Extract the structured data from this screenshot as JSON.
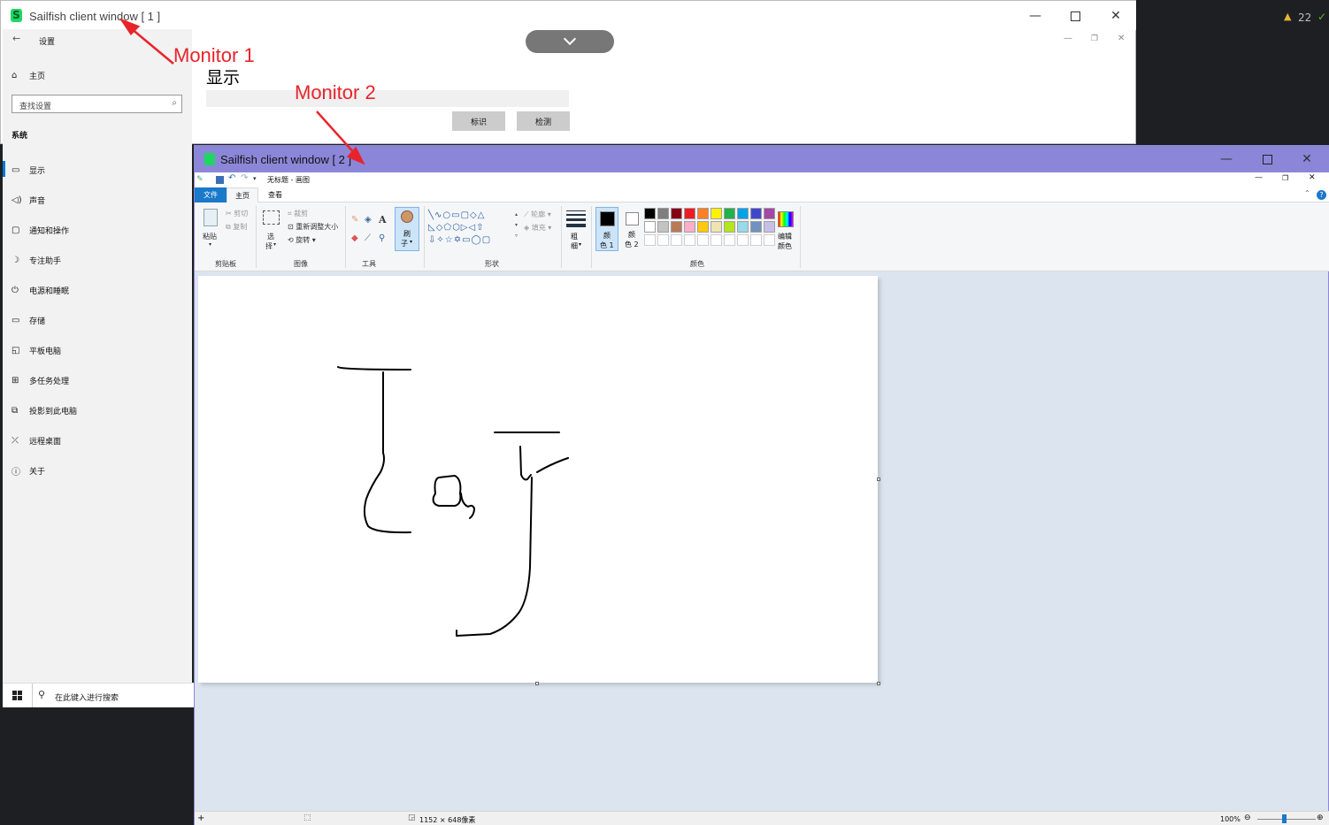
{
  "window1": {
    "title": "Sailfish client window [ 1 ]",
    "dropdown_icon": "chevron-down-icon",
    "page_heading": "显示",
    "buttons": [
      "标识",
      "检测"
    ]
  },
  "settings": {
    "back_label": "设置",
    "home": "主页",
    "search_placeholder": "查找设置",
    "section": "系统",
    "items": [
      {
        "label": "显示",
        "icon": "monitor-icon"
      },
      {
        "label": "声音",
        "icon": "speaker-icon"
      },
      {
        "label": "通知和操作",
        "icon": "notification-icon"
      },
      {
        "label": "专注助手",
        "icon": "moon-icon"
      },
      {
        "label": "电源和睡眠",
        "icon": "power-icon"
      },
      {
        "label": "存储",
        "icon": "storage-icon"
      },
      {
        "label": "平板电脑",
        "icon": "tablet-icon"
      },
      {
        "label": "多任务处理",
        "icon": "multitask-icon"
      },
      {
        "label": "投影到此电脑",
        "icon": "project-icon"
      },
      {
        "label": "远程桌面",
        "icon": "remote-icon"
      },
      {
        "label": "关于",
        "icon": "info-icon"
      }
    ]
  },
  "taskbar": {
    "search_placeholder": "在此键入进行搜索"
  },
  "ide": {
    "warning_count": "22"
  },
  "annotations": {
    "monitor1": "Monitor 1",
    "monitor2": "Monitor 2"
  },
  "window2": {
    "title": "Sailfish client window [ 2 ]",
    "document_title": "无标题 - 画图",
    "tabs": [
      "文件",
      "主页",
      "查看"
    ],
    "clipboard": {
      "paste": "粘贴",
      "cut": "剪切",
      "copy": "复制",
      "group": "剪贴板"
    },
    "image": {
      "select_1": "选",
      "select_2": "择",
      "crop": "裁剪",
      "resize": "重新调整大小",
      "rotate": "旋转",
      "group": "图像"
    },
    "tools": {
      "group": "工具"
    },
    "brush": {
      "line1": "刷",
      "line2": "子"
    },
    "shapes": {
      "outline": "轮廓",
      "fill": "填充",
      "group": "形状"
    },
    "size": {
      "line1": "粗",
      "line2": "细"
    },
    "color1": {
      "line1": "颜",
      "line2": "色 1"
    },
    "color2": {
      "line1": "颜",
      "line2": "色 2"
    },
    "edit_colors": {
      "line1": "编辑",
      "line2": "颜色"
    },
    "colors_group": "颜色",
    "palette_row1": [
      "#000000",
      "#7f7f7f",
      "#880015",
      "#ed1c24",
      "#ff7f27",
      "#fff200",
      "#22b14c",
      "#00a2e8",
      "#3f48cc",
      "#a349a4"
    ],
    "palette_row2": [
      "#ffffff",
      "#c3c3c3",
      "#b97a57",
      "#ffaec9",
      "#ffc90e",
      "#efe4b0",
      "#b5e61d",
      "#99d9ea",
      "#7092be",
      "#c8bfe7"
    ],
    "status": {
      "dimensions": "1152 × 648像素",
      "zoom": "100%"
    }
  }
}
